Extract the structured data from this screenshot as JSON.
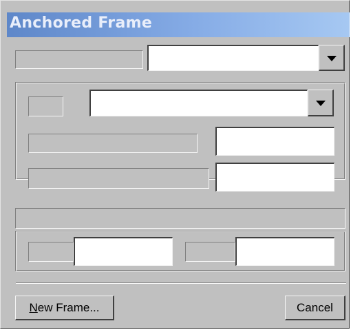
{
  "window": {
    "title": "Anchored Frame"
  },
  "top_row": {
    "select_value": "",
    "dropdown_icon": "dropdown-arrow-icon"
  },
  "group1": {
    "select_value": "",
    "field1_value": "",
    "field2_value": ""
  },
  "group2": {
    "field1_value": "",
    "field2_value": ""
  },
  "buttons": {
    "new_frame_mnemonic": "N",
    "new_frame_rest": "ew Frame...",
    "cancel": "Cancel"
  }
}
